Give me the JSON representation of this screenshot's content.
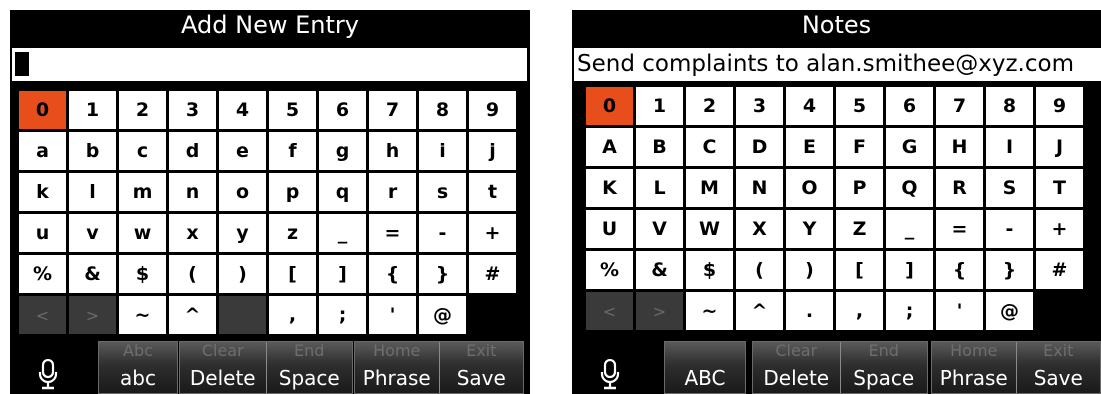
{
  "left": {
    "title": "Add New Entry",
    "entry_text": "",
    "keys": [
      [
        "0",
        "1",
        "2",
        "3",
        "4",
        "5",
        "6",
        "7",
        "8",
        "9"
      ],
      [
        "a",
        "b",
        "c",
        "d",
        "e",
        "f",
        "g",
        "h",
        "i",
        "j"
      ],
      [
        "k",
        "l",
        "m",
        "n",
        "o",
        "p",
        "q",
        "r",
        "s",
        "t"
      ],
      [
        "u",
        "v",
        "w",
        "x",
        "y",
        "z",
        "_",
        "=",
        "-",
        "+"
      ],
      [
        "%",
        "&",
        "$",
        "(",
        ")",
        "[",
        "]",
        "{",
        "}",
        "#"
      ],
      [
        "<",
        ">",
        "~",
        "^",
        "",
        ",",
        ";",
        "'",
        "@",
        ""
      ]
    ],
    "disabled_keys": [
      [
        5,
        0
      ],
      [
        5,
        1
      ],
      [
        5,
        4
      ]
    ],
    "empty_keys": [
      [
        5,
        9
      ]
    ],
    "selected_key": [
      0,
      0
    ],
    "softkeys": [
      {
        "top": "Abc",
        "main": "abc"
      },
      {
        "top": "Clear",
        "main": "Delete"
      },
      {
        "top": "End",
        "main": "Space"
      },
      {
        "top": "Home",
        "main": "Phrase"
      },
      {
        "top": "Exit",
        "main": "Save"
      }
    ]
  },
  "right": {
    "title": "Notes",
    "entry_text": "Send complaints to alan.smithee@xyz.com",
    "keys": [
      [
        "0",
        "1",
        "2",
        "3",
        "4",
        "5",
        "6",
        "7",
        "8",
        "9"
      ],
      [
        "A",
        "B",
        "C",
        "D",
        "E",
        "F",
        "G",
        "H",
        "I",
        "J"
      ],
      [
        "K",
        "L",
        "M",
        "N",
        "O",
        "P",
        "Q",
        "R",
        "S",
        "T"
      ],
      [
        "U",
        "V",
        "W",
        "X",
        "Y",
        "Z",
        "_",
        "=",
        "-",
        "+"
      ],
      [
        "%",
        "&",
        "$",
        "(",
        ")",
        "[",
        "]",
        "{",
        "}",
        "#"
      ],
      [
        "<",
        ">",
        "~",
        "^",
        ".",
        ",",
        ";",
        "'",
        "@",
        ""
      ]
    ],
    "disabled_keys": [
      [
        5,
        0
      ],
      [
        5,
        1
      ]
    ],
    "empty_keys": [
      [
        5,
        9
      ]
    ],
    "selected_key": [
      0,
      0
    ],
    "softkeys": [
      {
        "top": "",
        "main": "ABC"
      },
      {
        "top": "Clear",
        "main": "Delete"
      },
      {
        "top": "End",
        "main": "Space"
      },
      {
        "top": "Home",
        "main": "Phrase"
      },
      {
        "top": "Exit",
        "main": "Save"
      }
    ]
  },
  "icons": {
    "mic": "microphone-icon"
  },
  "colors": {
    "selected_key": "#e84e1b",
    "panel_background": "#000000",
    "key_background": "#ffffff",
    "disabled_key": "#3a3a3a"
  }
}
